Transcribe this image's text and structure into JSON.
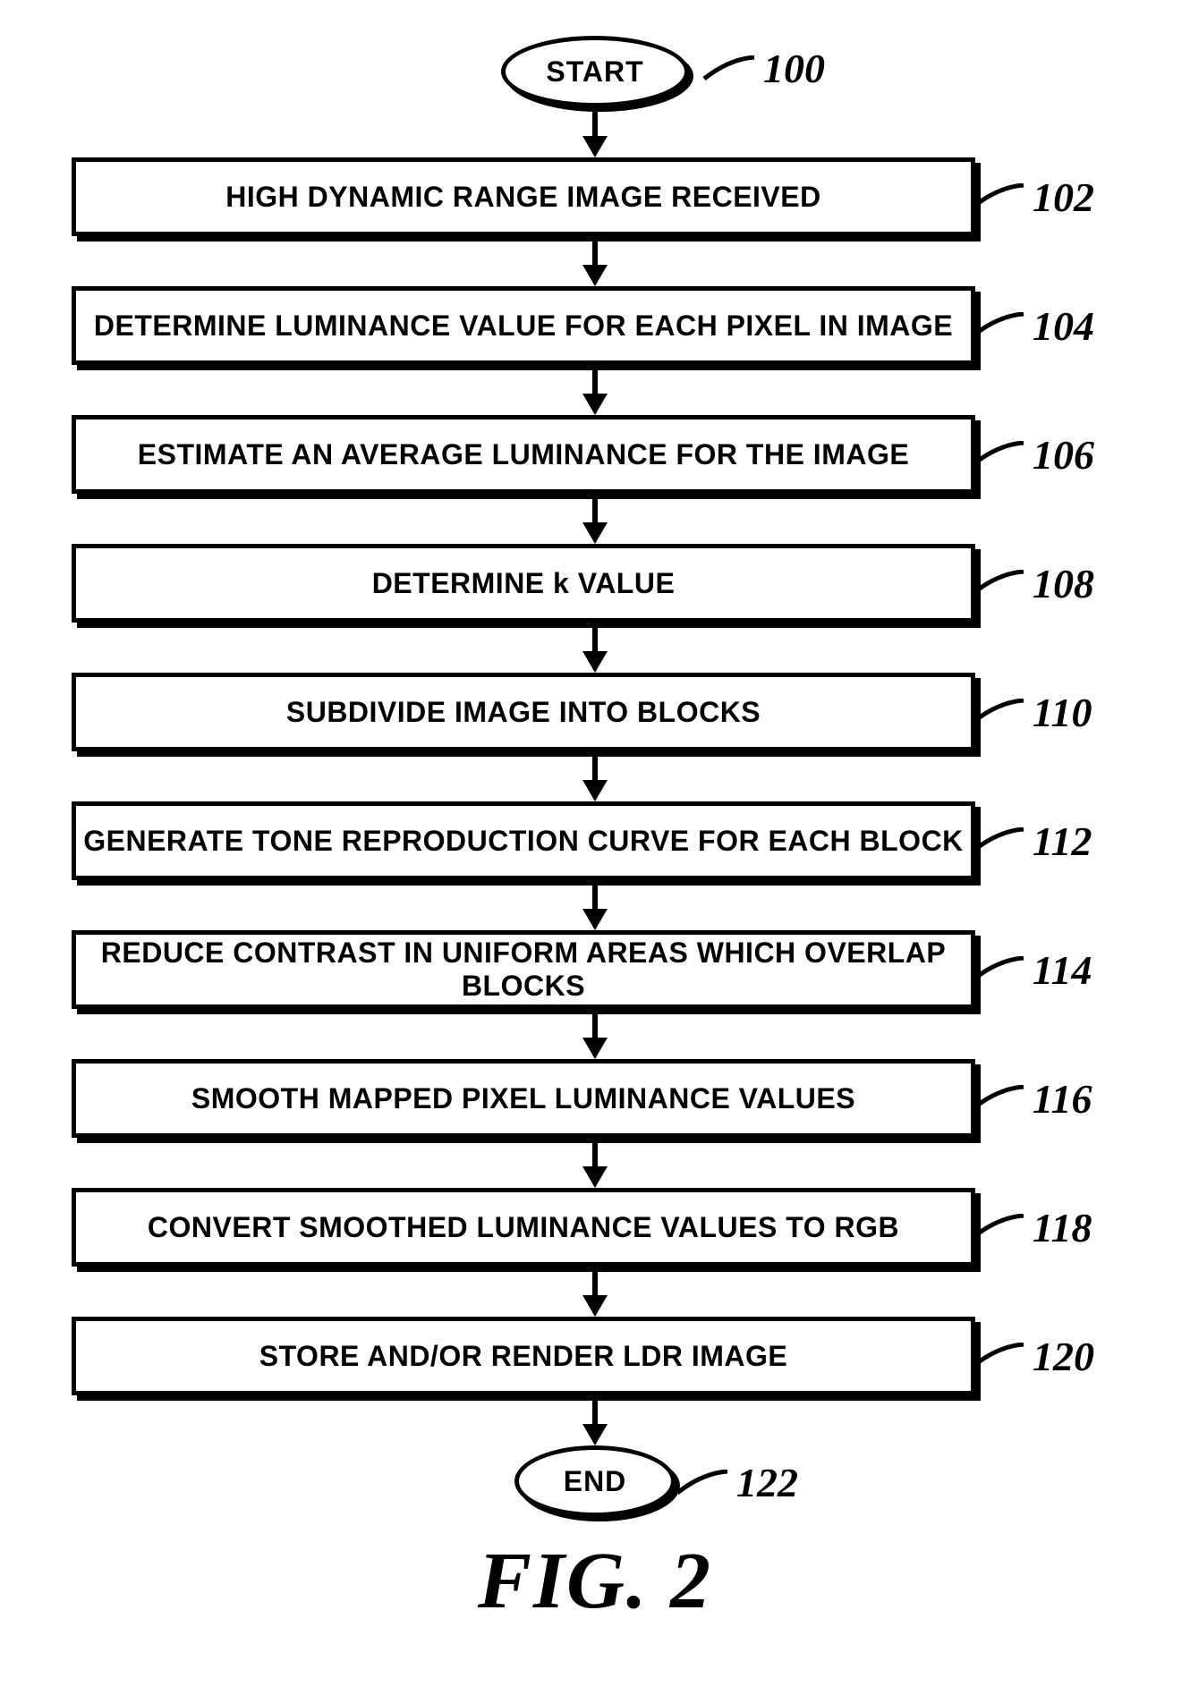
{
  "chart_data": {
    "type": "flowchart",
    "title": "FIG. 2",
    "nodes": [
      {
        "id": "100",
        "type": "terminal",
        "text": "START"
      },
      {
        "id": "102",
        "type": "process",
        "text": "HIGH DYNAMIC RANGE IMAGE RECEIVED"
      },
      {
        "id": "104",
        "type": "process",
        "text": "DETERMINE LUMINANCE VALUE FOR EACH PIXEL IN IMAGE"
      },
      {
        "id": "106",
        "type": "process",
        "text": "ESTIMATE AN AVERAGE LUMINANCE FOR THE IMAGE"
      },
      {
        "id": "108",
        "type": "process",
        "text": "DETERMINE k VALUE"
      },
      {
        "id": "110",
        "type": "process",
        "text": "SUBDIVIDE IMAGE INTO BLOCKS"
      },
      {
        "id": "112",
        "type": "process",
        "text": "GENERATE TONE REPRODUCTION CURVE FOR EACH BLOCK"
      },
      {
        "id": "114",
        "type": "process",
        "text": "REDUCE CONTRAST IN UNIFORM AREAS WHICH OVERLAP BLOCKS"
      },
      {
        "id": "116",
        "type": "process",
        "text": "SMOOTH MAPPED PIXEL LUMINANCE VALUES"
      },
      {
        "id": "118",
        "type": "process",
        "text": "CONVERT SMOOTHED LUMINANCE VALUES TO RGB"
      },
      {
        "id": "120",
        "type": "process",
        "text": "STORE AND/OR RENDER LDR IMAGE"
      },
      {
        "id": "122",
        "type": "terminal",
        "text": "END"
      }
    ],
    "edges": [
      {
        "from": "100",
        "to": "102"
      },
      {
        "from": "102",
        "to": "104"
      },
      {
        "from": "104",
        "to": "106"
      },
      {
        "from": "106",
        "to": "108"
      },
      {
        "from": "108",
        "to": "110"
      },
      {
        "from": "110",
        "to": "112"
      },
      {
        "from": "112",
        "to": "114"
      },
      {
        "from": "114",
        "to": "116"
      },
      {
        "from": "116",
        "to": "118"
      },
      {
        "from": "118",
        "to": "120"
      },
      {
        "from": "120",
        "to": "122"
      }
    ]
  },
  "start": {
    "text": "START",
    "ref": "100"
  },
  "end": {
    "text": "END",
    "ref": "122"
  },
  "steps": [
    {
      "text": "HIGH DYNAMIC RANGE IMAGE RECEIVED",
      "ref": "102"
    },
    {
      "text": "DETERMINE LUMINANCE VALUE FOR EACH PIXEL IN IMAGE",
      "ref": "104"
    },
    {
      "text": "ESTIMATE AN AVERAGE LUMINANCE FOR THE IMAGE",
      "ref": "106"
    },
    {
      "text": "DETERMINE k VALUE",
      "ref": "108"
    },
    {
      "text": "SUBDIVIDE IMAGE INTO BLOCKS",
      "ref": "110"
    },
    {
      "text": "GENERATE TONE REPRODUCTION CURVE FOR EACH BLOCK",
      "ref": "112"
    },
    {
      "text": "REDUCE CONTRAST IN UNIFORM AREAS WHICH OVERLAP BLOCKS",
      "ref": "114"
    },
    {
      "text": "SMOOTH MAPPED PIXEL LUMINANCE VALUES",
      "ref": "116"
    },
    {
      "text": "CONVERT SMOOTHED LUMINANCE VALUES TO RGB",
      "ref": "118"
    },
    {
      "text": "STORE AND/OR RENDER LDR IMAGE",
      "ref": "120"
    }
  ],
  "figure": "FIG. 2"
}
